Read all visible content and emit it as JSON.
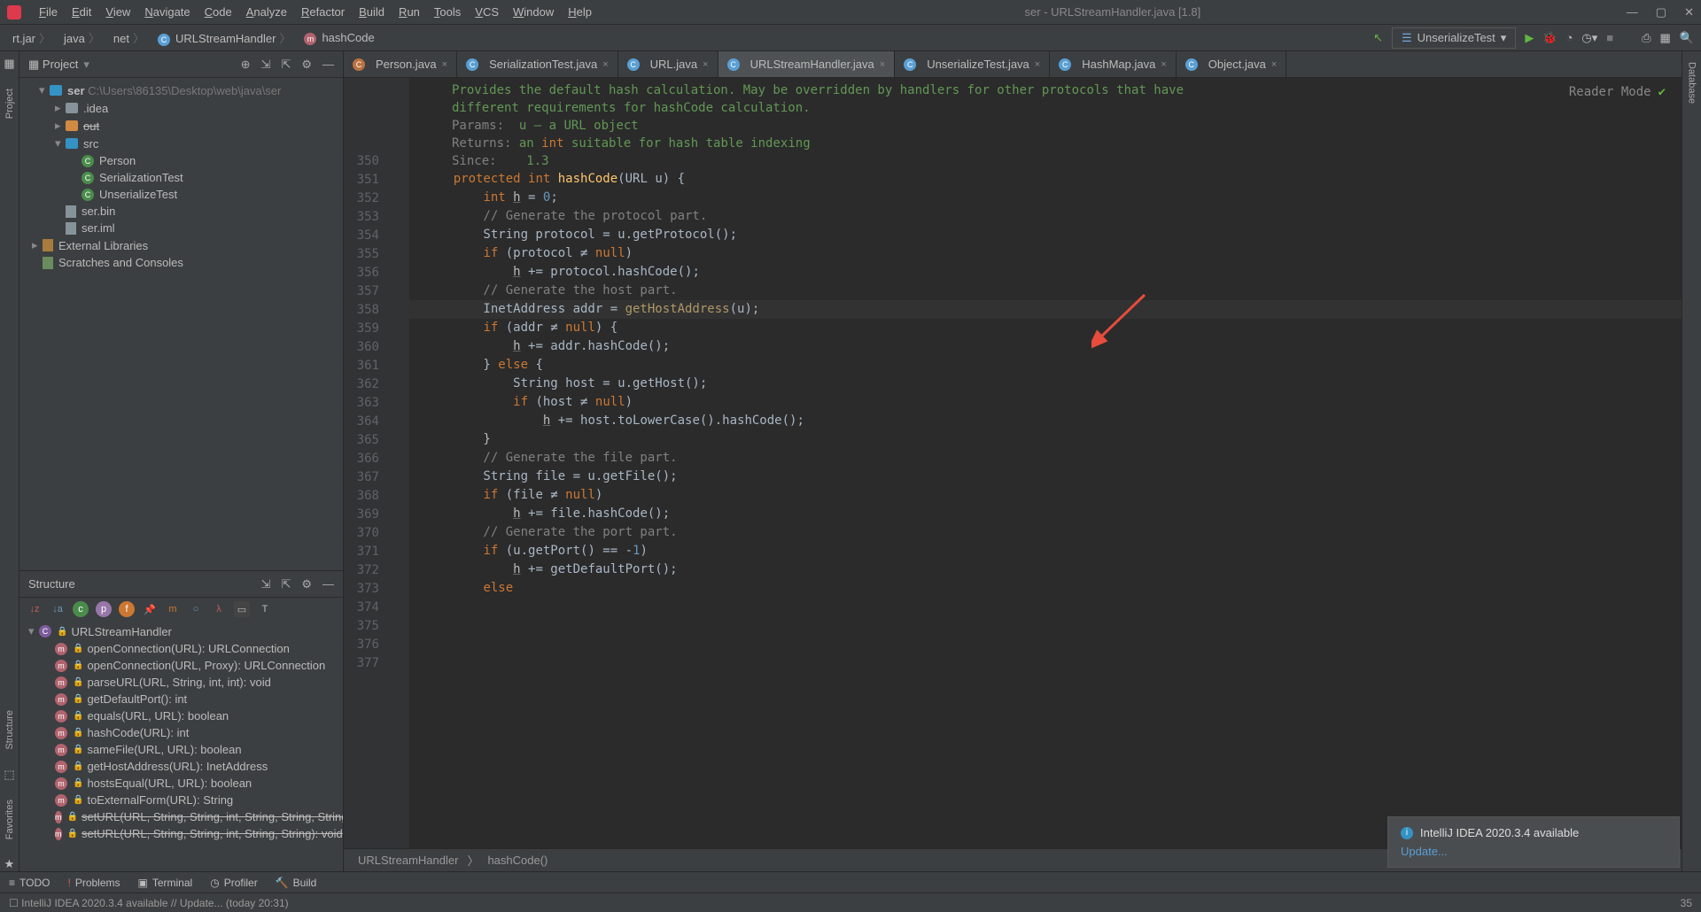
{
  "menu": [
    "File",
    "Edit",
    "View",
    "Navigate",
    "Code",
    "Analyze",
    "Refactor",
    "Build",
    "Run",
    "Tools",
    "VCS",
    "Window",
    "Help"
  ],
  "window_title": "ser - URLStreamHandler.java [1.8]",
  "breadcrumb": [
    "rt.jar",
    "java",
    "net",
    "URLStreamHandler",
    "hashCode"
  ],
  "run_config": "UnserializeTest",
  "project_panel": {
    "title": "Project"
  },
  "project_tree": {
    "root": {
      "name": "ser",
      "path": "C:\\Users\\86135\\Desktop\\web\\java\\ser"
    },
    "idea": ".idea",
    "out": "out",
    "src": "src",
    "classes": [
      "Person",
      "SerializationTest",
      "UnserializeTest"
    ],
    "files": [
      "ser.bin",
      "ser.iml"
    ],
    "ext": "External Libraries",
    "scratch": "Scratches and Consoles"
  },
  "structure": {
    "title": "Structure",
    "class": "URLStreamHandler",
    "methods": [
      "openConnection(URL): URLConnection",
      "openConnection(URL, Proxy): URLConnection",
      "parseURL(URL, String, int, int): void",
      "getDefaultPort(): int",
      "equals(URL, URL): boolean",
      "hashCode(URL): int",
      "sameFile(URL, URL): boolean",
      "getHostAddress(URL): InetAddress",
      "hostsEqual(URL, URL): boolean",
      "toExternalForm(URL): String",
      "setURL(URL, String, String, int, String, String, String, String, String): void",
      "setURL(URL, String, String, int, String, String): void"
    ]
  },
  "tabs": [
    {
      "label": "Person.java",
      "icon": "C",
      "color": "#ba7240"
    },
    {
      "label": "SerializationTest.java",
      "icon": "C",
      "color": "#5a9fd4"
    },
    {
      "label": "URL.java",
      "icon": "C",
      "color": "#5a9fd4"
    },
    {
      "label": "URLStreamHandler.java",
      "icon": "C",
      "color": "#5a9fd4",
      "active": true
    },
    {
      "label": "UnserializeTest.java",
      "icon": "C",
      "color": "#5a9fd4"
    },
    {
      "label": "HashMap.java",
      "icon": "C",
      "color": "#5a9fd4"
    },
    {
      "label": "Object.java",
      "icon": "C",
      "color": "#5a9fd4"
    }
  ],
  "reader_mode": "Reader Mode",
  "doc": {
    "l1": "Provides the default hash calculation. May be overridden by handlers for other protocols that have",
    "l2": "different requirements for hashCode calculation.",
    "params": "Params:",
    "params_v": "u – a URL object",
    "returns": "Returns:",
    "returns_v": "an int suitable for hash table indexing",
    "since": "Since:",
    "since_v": "1.3"
  },
  "line_start": 350,
  "lines": [
    {
      "t": "    protected int hashCode(URL u) {",
      "n": 350,
      "tokens": [
        [
          "    ",
          "op"
        ],
        [
          "protected ",
          "kw"
        ],
        [
          "int ",
          "kw"
        ],
        [
          "hashCode",
          "method"
        ],
        [
          "(",
          "op"
        ],
        [
          "URL u",
          "type"
        ],
        [
          ") {",
          "op"
        ]
      ]
    },
    {
      "t": "        int h = 0;",
      "n": 351,
      "tokens": [
        [
          "        ",
          "op"
        ],
        [
          "int ",
          "kw"
        ],
        [
          "h",
          "var-u"
        ],
        [
          " = ",
          "op"
        ],
        [
          "0",
          "num"
        ],
        [
          ";",
          "op"
        ]
      ]
    },
    {
      "t": "",
      "n": 352
    },
    {
      "t": "        // Generate the protocol part.",
      "n": 353,
      "cls": "comment"
    },
    {
      "t": "        String protocol = u.getProtocol();",
      "n": 354,
      "tokens": [
        [
          "        String protocol = u.getProtocol();",
          "type"
        ]
      ]
    },
    {
      "t": "        if (protocol ≠ null)",
      "n": 355,
      "tokens": [
        [
          "        ",
          "op"
        ],
        [
          "if ",
          "kw"
        ],
        [
          "(protocol ",
          "type"
        ],
        [
          "≠ ",
          "op"
        ],
        [
          "null",
          "kw"
        ],
        [
          ")",
          "op"
        ]
      ]
    },
    {
      "t": "            h += protocol.hashCode();",
      "n": 356,
      "tokens": [
        [
          "            ",
          "op"
        ],
        [
          "h",
          "var-u"
        ],
        [
          " += protocol.hashCode();",
          "type"
        ]
      ]
    },
    {
      "t": "",
      "n": 357
    },
    {
      "t": "        // Generate the host part.",
      "n": 358,
      "cls": "comment"
    },
    {
      "t": "        InetAddress addr = getHostAddress(u);",
      "n": 359,
      "hl": true,
      "tokens": [
        [
          "        InetAddress addr = ",
          "type"
        ],
        [
          "getHostAddress",
          "call-ul"
        ],
        [
          "(u);",
          "type"
        ]
      ]
    },
    {
      "t": "        if (addr ≠ null) {",
      "n": 360,
      "tokens": [
        [
          "        ",
          "op"
        ],
        [
          "if ",
          "kw"
        ],
        [
          "(addr ",
          "type"
        ],
        [
          "≠ ",
          "op"
        ],
        [
          "null",
          "kw"
        ],
        [
          ") {",
          "op"
        ]
      ]
    },
    {
      "t": "            h += addr.hashCode();",
      "n": 361,
      "tokens": [
        [
          "            ",
          "op"
        ],
        [
          "h",
          "var-u"
        ],
        [
          " += addr.hashCode();",
          "type"
        ]
      ]
    },
    {
      "t": "        } else {",
      "n": 362,
      "tokens": [
        [
          "        } ",
          "op"
        ],
        [
          "else ",
          "kw"
        ],
        [
          "{",
          "op"
        ]
      ]
    },
    {
      "t": "            String host = u.getHost();",
      "n": 363,
      "tokens": [
        [
          "            String host = u.getHost();",
          "type"
        ]
      ]
    },
    {
      "t": "            if (host ≠ null)",
      "n": 364,
      "tokens": [
        [
          "            ",
          "op"
        ],
        [
          "if ",
          "kw"
        ],
        [
          "(host ",
          "type"
        ],
        [
          "≠ ",
          "op"
        ],
        [
          "null",
          "kw"
        ],
        [
          ")",
          "op"
        ]
      ]
    },
    {
      "t": "                h += host.toLowerCase().hashCode();",
      "n": 365,
      "tokens": [
        [
          "                ",
          "op"
        ],
        [
          "h",
          "var-u"
        ],
        [
          " += host.toLowerCase().hashCode();",
          "type"
        ]
      ]
    },
    {
      "t": "        }",
      "n": 366
    },
    {
      "t": "",
      "n": 367
    },
    {
      "t": "        // Generate the file part.",
      "n": 368,
      "cls": "comment"
    },
    {
      "t": "        String file = u.getFile();",
      "n": 369,
      "tokens": [
        [
          "        String file = u.getFile();",
          "type"
        ]
      ]
    },
    {
      "t": "        if (file ≠ null)",
      "n": 370,
      "tokens": [
        [
          "        ",
          "op"
        ],
        [
          "if ",
          "kw"
        ],
        [
          "(file ",
          "type"
        ],
        [
          "≠ ",
          "op"
        ],
        [
          "null",
          "kw"
        ],
        [
          ")",
          "op"
        ]
      ]
    },
    {
      "t": "            h += file.hashCode();",
      "n": 371,
      "tokens": [
        [
          "            ",
          "op"
        ],
        [
          "h",
          "var-u"
        ],
        [
          " += file.hashCode();",
          "type"
        ]
      ]
    },
    {
      "t": "",
      "n": 372
    },
    {
      "t": "        // Generate the port part.",
      "n": 373,
      "cls": "comment"
    },
    {
      "t": "        if (u.getPort() == -1)",
      "n": 374,
      "tokens": [
        [
          "        ",
          "op"
        ],
        [
          "if ",
          "kw"
        ],
        [
          "(u.getPort() == -",
          "type"
        ],
        [
          "1",
          "num"
        ],
        [
          ")",
          "op"
        ]
      ]
    },
    {
      "t": "            h += getDefaultPort();",
      "n": 375,
      "tokens": [
        [
          "            ",
          "op"
        ],
        [
          "h",
          "var-u"
        ],
        [
          " += getDefaultPort();",
          "type"
        ]
      ]
    },
    {
      "t": "        else",
      "n": 376,
      "tokens": [
        [
          "        ",
          "op"
        ],
        [
          "else",
          "kw"
        ]
      ]
    },
    {
      "t": "",
      "n": 377
    }
  ],
  "editor_footer": [
    "URLStreamHandler",
    "hashCode()"
  ],
  "notification": {
    "title": "IntelliJ IDEA 2020.3.4 available",
    "link": "Update..."
  },
  "bottom_bar": {
    "todo": "TODO",
    "problems": "Problems",
    "terminal": "Terminal",
    "profiler": "Profiler",
    "build": "Build"
  },
  "status": {
    "left": "IntelliJ IDEA 2020.3.4 available // Update... (today 20:31)",
    "right": "35"
  },
  "rails": {
    "project": "Project",
    "structure": "Structure",
    "favorites": "Favorites",
    "database": "Database"
  }
}
